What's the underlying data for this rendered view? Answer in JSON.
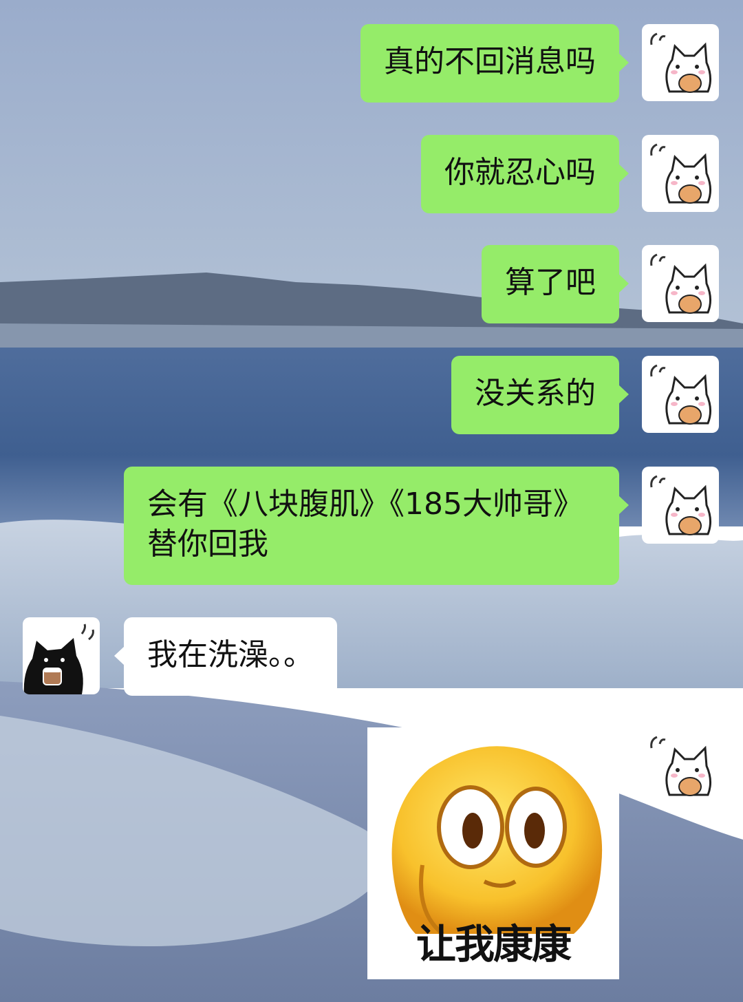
{
  "chat": {
    "messages": [
      {
        "sender": "me",
        "text": "真的不回消息吗"
      },
      {
        "sender": "me",
        "text": "你就忍心吗"
      },
      {
        "sender": "me",
        "text": "算了吧"
      },
      {
        "sender": "me",
        "text": "没关系的"
      },
      {
        "sender": "me",
        "text": "会有《八块腹肌》《185大帅哥》\n替你回我"
      },
      {
        "sender": "other",
        "text": "我在洗澡。。"
      },
      {
        "sender": "me",
        "type": "sticker",
        "caption": "让我康康",
        "icon": "shocked-face-sticker"
      }
    ]
  },
  "avatars": {
    "me": "white-cat-avatar-icon",
    "other": "black-cat-avatar-icon"
  },
  "colors": {
    "my_bubble": "#95ec69",
    "other_bubble": "#ffffff",
    "text": "#111111"
  }
}
